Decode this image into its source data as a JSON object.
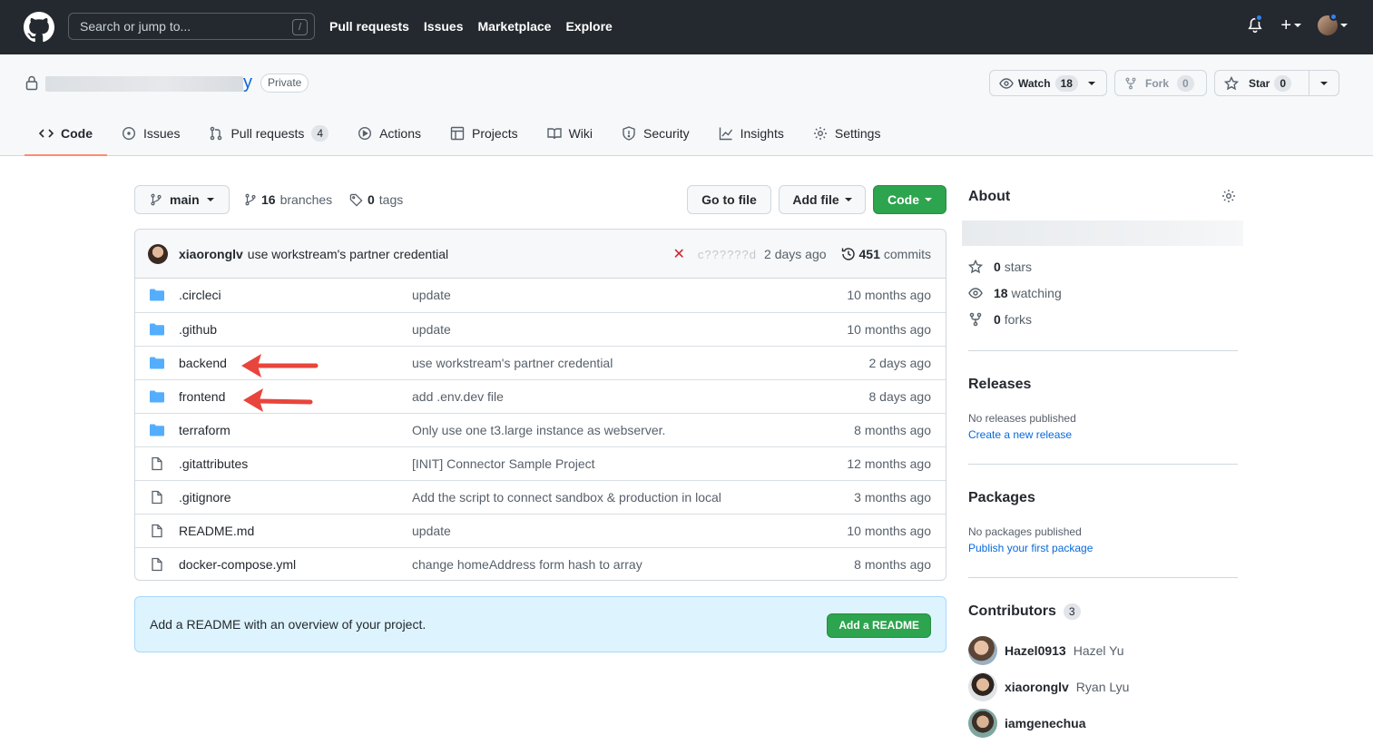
{
  "header": {
    "search_placeholder": "Search or jump to...",
    "search_key": "/",
    "nav": [
      "Pull requests",
      "Issues",
      "Marketplace",
      "Explore"
    ],
    "plus": "+"
  },
  "repo": {
    "name_tail": "y",
    "visibility": "Private",
    "watch_label": "Watch",
    "watch_count": "18",
    "fork_label": "Fork",
    "fork_count": "0",
    "star_label": "Star",
    "star_count": "0",
    "tabs": [
      {
        "label": "Code"
      },
      {
        "label": "Issues"
      },
      {
        "label": "Pull requests",
        "count": "4"
      },
      {
        "label": "Actions"
      },
      {
        "label": "Projects"
      },
      {
        "label": "Wiki"
      },
      {
        "label": "Security"
      },
      {
        "label": "Insights"
      },
      {
        "label": "Settings"
      }
    ]
  },
  "toolbar": {
    "branch": "main",
    "branches_count": "16",
    "branches_label": "branches",
    "tags_count": "0",
    "tags_label": "tags",
    "go_to_file": "Go to file",
    "add_file": "Add file",
    "code": "Code"
  },
  "commit": {
    "author": "xiaoronglv",
    "message": "use workstream's partner credential",
    "sha": "c??????d",
    "time": "2 days ago",
    "commits_count": "451",
    "commits_label": "commits"
  },
  "files": [
    {
      "type": "dir",
      "name": ".circleci",
      "message": "update",
      "age": "10 months ago"
    },
    {
      "type": "dir",
      "name": ".github",
      "message": "update",
      "age": "10 months ago"
    },
    {
      "type": "dir",
      "name": "backend",
      "message": "use workstream's partner credential",
      "age": "2 days ago"
    },
    {
      "type": "dir",
      "name": "frontend",
      "message": "add .env.dev file",
      "age": "8 days ago"
    },
    {
      "type": "dir",
      "name": "terraform",
      "message": "Only use one t3.large instance as webserver.",
      "age": "8 months ago"
    },
    {
      "type": "file",
      "name": ".gitattributes",
      "message": "[INIT] Connector Sample Project",
      "age": "12 months ago"
    },
    {
      "type": "file",
      "name": ".gitignore",
      "message": "Add the script to connect sandbox & production in local",
      "age": "3 months ago"
    },
    {
      "type": "file",
      "name": "README.md",
      "message": "update",
      "age": "10 months ago"
    },
    {
      "type": "file",
      "name": "docker-compose.yml",
      "message": "change homeAddress form hash to array",
      "age": "8 months ago"
    }
  ],
  "readme_prompt": {
    "text": "Add a README with an overview of your project.",
    "button": "Add a README"
  },
  "sidebar": {
    "about_title": "About",
    "stars_count": "0",
    "stars_label": "stars",
    "watching_count": "18",
    "watching_label": "watching",
    "forks_count": "0",
    "forks_label": "forks",
    "releases_title": "Releases",
    "releases_empty": "No releases published",
    "releases_link": "Create a new release",
    "packages_title": "Packages",
    "packages_empty": "No packages published",
    "packages_link": "Publish your first package",
    "contributors_title": "Contributors",
    "contributors_count": "3",
    "contributors": [
      {
        "login": "Hazel0913",
        "name": "Hazel Yu"
      },
      {
        "login": "xiaoronglv",
        "name": "Ryan Lyu"
      },
      {
        "login": "iamgenechua",
        "name": ""
      }
    ]
  },
  "colors": {
    "header_bg": "#24292f",
    "accent_green": "#2da44e",
    "link_blue": "#0969da",
    "folder_blue": "#54aeff",
    "tab_underline": "#fd8c73",
    "arrow_red": "#e8453c"
  }
}
